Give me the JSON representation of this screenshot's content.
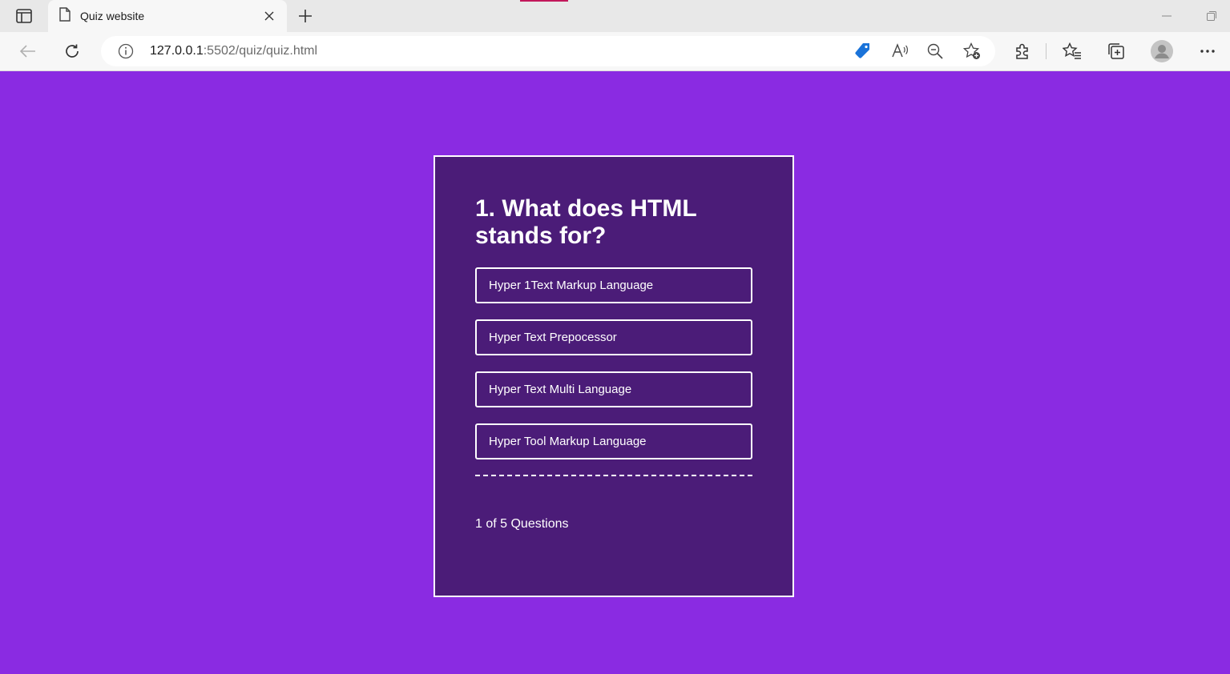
{
  "browser": {
    "tab_title": "Quiz website",
    "url_host": "127.0.0.1",
    "url_rest": ":5502/quiz/quiz.html",
    "icons": [
      "tab-actions-icon",
      "page-icon",
      "close-icon",
      "plus-icon",
      "minimize-icon",
      "restore-icon",
      "back-arrow-icon",
      "refresh-icon",
      "info-icon",
      "shopping-tag-icon",
      "read-aloud-icon",
      "zoom-out-icon",
      "add-favorite-icon",
      "extensions-icon",
      "favorites-icon",
      "collections-icon",
      "profile-avatar-icon",
      "more-menu-icon"
    ]
  },
  "quiz": {
    "question": "1. What does HTML stands for?",
    "options": [
      "Hyper 1Text Markup Language",
      "Hyper Text Prepocessor",
      "Hyper Text Multi Language",
      "Hyper Tool Markup Language"
    ],
    "counter": "1 of 5 Questions"
  },
  "colors": {
    "page_background": "#8a2be2",
    "card_background": "#4b1c78",
    "text": "#ffffff"
  }
}
